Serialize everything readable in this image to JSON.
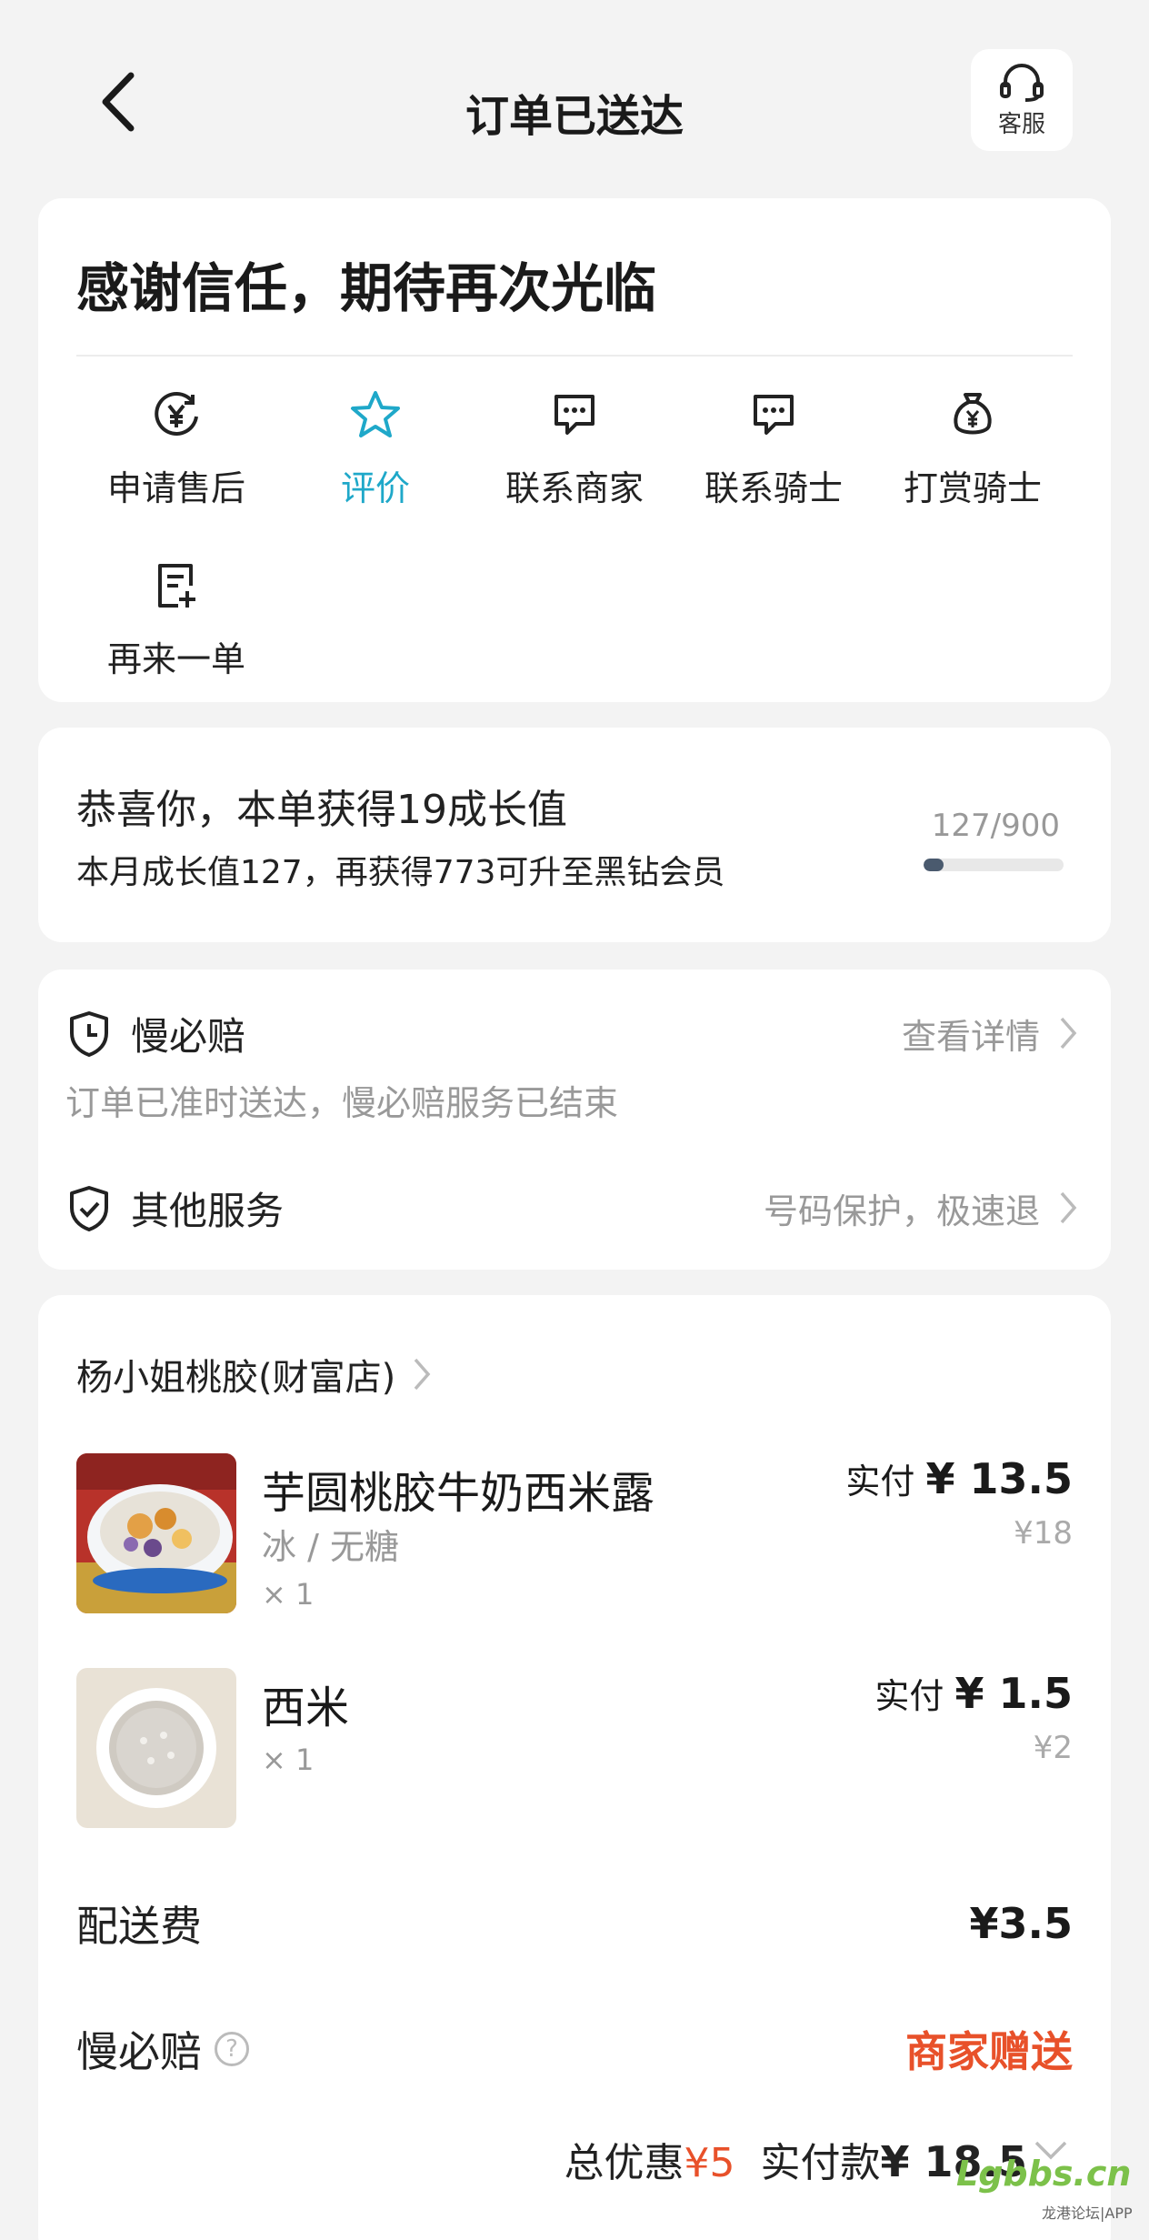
{
  "header": {
    "title": "订单已送达",
    "customer_service_label": "客服"
  },
  "status_card": {
    "message": "感谢信任，期待再次光临",
    "actions": [
      {
        "label": "申请售后",
        "icon": "refund-yen-icon"
      },
      {
        "label": "评价",
        "icon": "star-icon",
        "active": true
      },
      {
        "label": "联系商家",
        "icon": "chat-bubble-icon"
      },
      {
        "label": "联系骑士",
        "icon": "chat-bubble-icon"
      },
      {
        "label": "打赏骑士",
        "icon": "money-bag-icon"
      },
      {
        "label": "再来一单",
        "icon": "reorder-doc-icon"
      }
    ],
    "active_color": "#1fa8c9"
  },
  "growth": {
    "headline": "恭喜你，本单获得19成长值",
    "detail": "本月成长值127，再获得773可升至黑钻会员",
    "progress_text": "127/900",
    "progress_fraction": 0.141
  },
  "services": {
    "late_guarantee": {
      "name": "慢必赔",
      "link": "查看详情",
      "status": "订单已准时送达，慢必赔服务已结束"
    },
    "other": {
      "name": "其他服务",
      "summary": "号码保护，极速退"
    }
  },
  "order": {
    "shop_name": "杨小姐桃胶(财富店)",
    "items": [
      {
        "name": "芋圆桃胶牛奶西米露",
        "spec": "冰 / 无糖",
        "qty": "× 1",
        "paid_label": "实付",
        "paid_amount": "¥ 13.5",
        "original_price": "¥18"
      },
      {
        "name": "西米",
        "spec": "",
        "qty": "× 1",
        "paid_label": "实付",
        "paid_amount": "¥ 1.5",
        "original_price": "¥2"
      }
    ],
    "delivery_fee": {
      "label": "配送费",
      "value": "¥3.5"
    },
    "late_guarantee_fee": {
      "label": "慢必赔",
      "value": "商家赠送"
    },
    "total": {
      "discount_label": "总优惠",
      "discount_value": "¥5",
      "paid_label": "实付款",
      "paid_value": "¥ 18.5"
    },
    "accent_red": "#e8512a"
  },
  "watermark": {
    "text": "Lgbbs.cn",
    "sub": "龙港论坛|APP"
  }
}
